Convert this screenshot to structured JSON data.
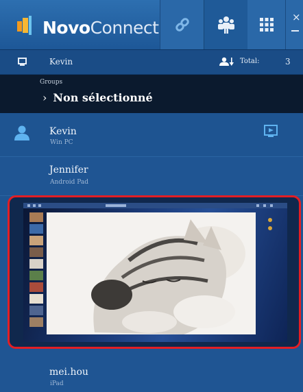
{
  "app": {
    "brand_bold": "Novo",
    "brand_rest": "Connect",
    "colors": {
      "header": "#2a68a8",
      "list": "#1f5593",
      "group_bar": "#0b1a2e",
      "highlight": "#e31e24",
      "logo_orange": "#f39a1e"
    }
  },
  "toolbar": {
    "buttons": [
      {
        "icon": "link-icon",
        "active": false
      },
      {
        "icon": "users-icon",
        "active": true
      },
      {
        "icon": "grid-icon",
        "active": false
      },
      {
        "icon": "close-icon",
        "active": false
      }
    ]
  },
  "info": {
    "user_name": "Kevin",
    "total_label": "Total:",
    "total_count": "3"
  },
  "group": {
    "label": "Groups",
    "selected": "Non sélectionné"
  },
  "users": [
    {
      "name": "Kevin",
      "device": "Win PC",
      "presenting": true
    },
    {
      "name": "Jennifer",
      "device": "Android Pad",
      "presenting": false
    },
    {
      "name": "mei.hou",
      "device": "iPad",
      "presenting": false
    }
  ]
}
